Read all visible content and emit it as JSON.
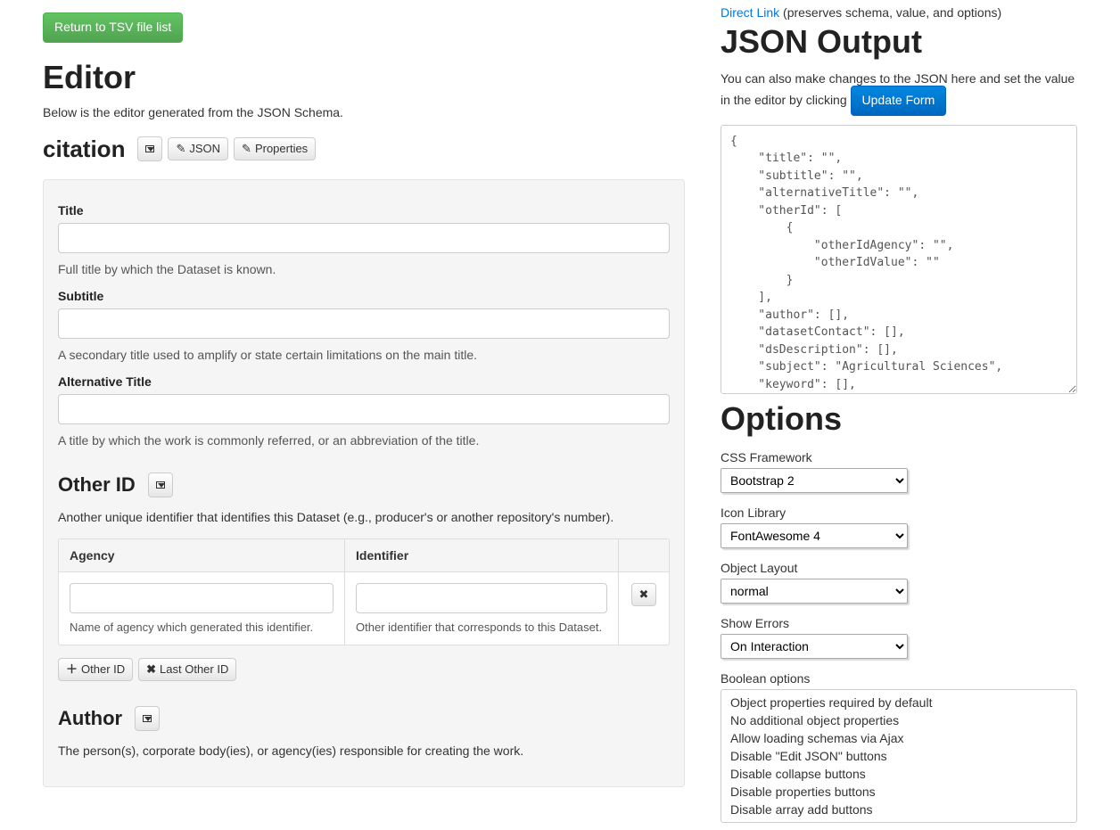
{
  "top": {
    "return_button": "Return to TSV file list",
    "editor_heading": "Editor",
    "editor_intro": "Below is the editor generated from the JSON Schema."
  },
  "citation": {
    "title": "citation",
    "json_btn": "JSON",
    "properties_btn": "Properties",
    "fields": {
      "title": {
        "label": "Title",
        "value": "",
        "help": "Full title by which the Dataset is known."
      },
      "subtitle": {
        "label": "Subtitle",
        "value": "",
        "help": "A secondary title used to amplify or state certain limitations on the main title."
      },
      "alternative_title": {
        "label": "Alternative Title",
        "value": "",
        "help": "A title by which the work is commonly referred, or an abbreviation of the title."
      }
    },
    "other_id": {
      "heading": "Other ID",
      "desc": "Another unique identifier that identifies this Dataset (e.g., producer's or another repository's number).",
      "cols": {
        "agency": "Agency",
        "identifier": "Identifier"
      },
      "row": {
        "agency_value": "",
        "agency_help": "Name of agency which generated this identifier.",
        "identifier_value": "",
        "identifier_help": "Other identifier that corresponds to this Dataset."
      },
      "add_btn": "Other ID",
      "last_btn": "Last Other ID"
    },
    "author": {
      "heading": "Author",
      "desc": "The person(s), corporate body(ies), or agency(ies) responsible for creating the work."
    }
  },
  "right": {
    "direct_link_text": "Direct Link",
    "direct_link_note": " (preserves schema, value, and options)",
    "json_output_heading": "JSON Output",
    "json_output_desc": "You can also make changes to the JSON here and set the value in the editor by clicking ",
    "update_form_btn": "Update Form",
    "json_content": "{\n    \"title\": \"\",\n    \"subtitle\": \"\",\n    \"alternativeTitle\": \"\",\n    \"otherId\": [\n        {\n            \"otherIdAgency\": \"\",\n            \"otherIdValue\": \"\"\n        }\n    ],\n    \"author\": [],\n    \"datasetContact\": [],\n    \"dsDescription\": [],\n    \"subject\": \"Agricultural Sciences\",\n    \"keyword\": [],",
    "options_heading": "Options",
    "opts": {
      "css_framework": {
        "label": "CSS Framework",
        "value": "Bootstrap 2"
      },
      "icon_library": {
        "label": "Icon Library",
        "value": "FontAwesome 4"
      },
      "object_layout": {
        "label": "Object Layout",
        "value": "normal"
      },
      "show_errors": {
        "label": "Show Errors",
        "value": "On Interaction"
      }
    },
    "bool_opts_label": "Boolean options",
    "bool_opts": [
      "Object properties required by default",
      "No additional object properties",
      "Allow loading schemas via Ajax",
      "Disable \"Edit JSON\" buttons",
      "Disable collapse buttons",
      "Disable properties buttons",
      "Disable array add buttons"
    ]
  }
}
